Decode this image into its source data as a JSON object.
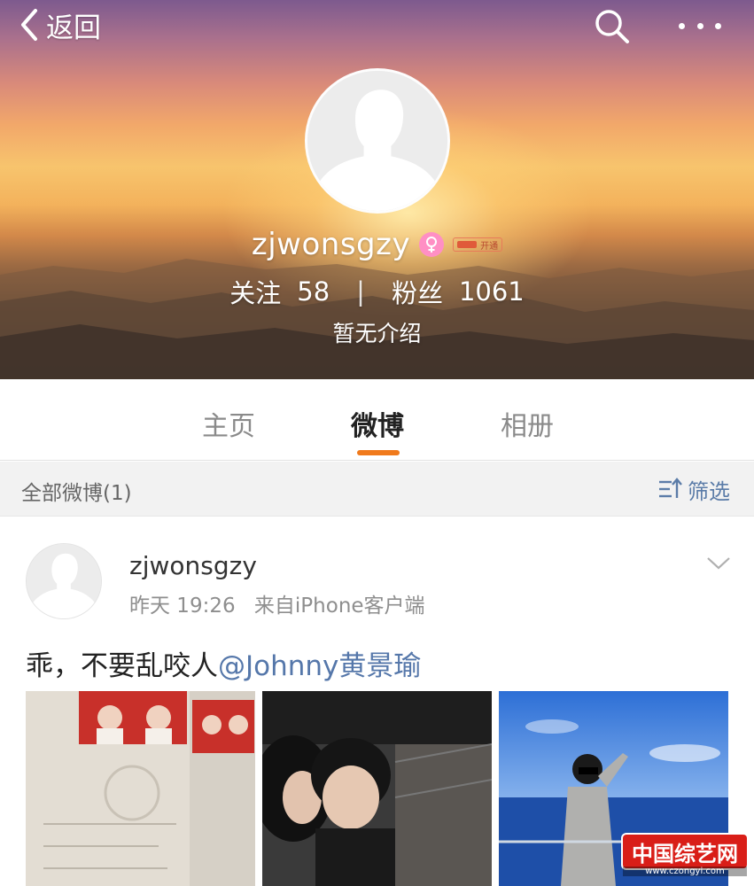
{
  "topbar": {
    "back_label": "返回",
    "search_icon": "search-icon",
    "more_icon": "more-icon"
  },
  "profile": {
    "name": "zjwonsgzy",
    "gender_icon": "female-icon",
    "badge_text": "开通",
    "follow_label": "关注",
    "follow_count": "58",
    "fans_label": "粉丝",
    "fans_count": "1061",
    "intro": "暂无介绍"
  },
  "tabs": [
    {
      "label": "主页",
      "active": false
    },
    {
      "label": "微博",
      "active": true
    },
    {
      "label": "相册",
      "active": false
    }
  ],
  "filter": {
    "count_label": "全部微博(1)",
    "filter_label": "筛选"
  },
  "post": {
    "author": "zjwonsgzy",
    "time": "昨天 19:26",
    "source": "来自iPhone客户端",
    "text": "乖，不要乱咬人",
    "mention": "@Johnny黄景瑜",
    "photos": [
      "photo-1",
      "photo-2",
      "photo-3"
    ]
  },
  "watermark": {
    "main": "中国综艺网",
    "url": "www.czongyi.com"
  },
  "colors": {
    "accent": "#f07a1c",
    "link": "#5577aa",
    "filter": "#5b7ca8"
  }
}
